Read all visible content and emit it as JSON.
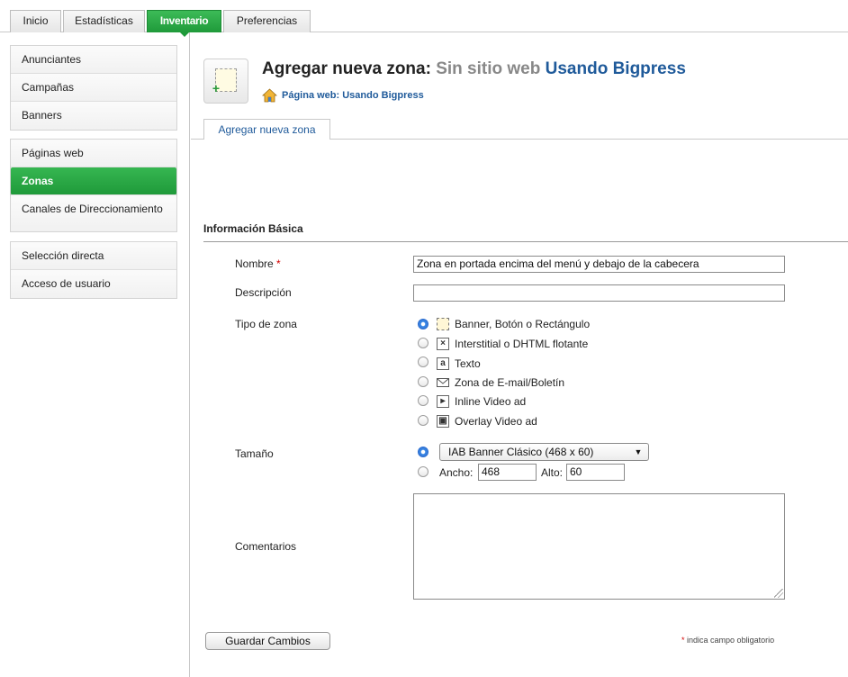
{
  "top_tabs": [
    {
      "label": "Inicio",
      "active": false
    },
    {
      "label": "Estadísticas",
      "active": false
    },
    {
      "label": "Inventario",
      "active": true
    },
    {
      "label": "Preferencias",
      "active": false
    }
  ],
  "sidebar": {
    "group1": [
      "Anunciantes",
      "Campañas",
      "Banners"
    ],
    "group2": [
      "Páginas web",
      "Zonas",
      "Canales de Direccionamiento"
    ],
    "group3": [
      "Selección directa",
      "Acceso de usuario"
    ],
    "active": "Zonas"
  },
  "header": {
    "title_prefix": "Agregar nueva zona:",
    "title_site": "Sin sitio web",
    "title_name": "Usando Bigpress",
    "subtitle": "Página web: Usando Bigpress"
  },
  "page_tab": "Agregar nueva zona",
  "section": "Información Básica",
  "form": {
    "nombre_label": "Nombre",
    "required_mark": "*",
    "nombre_value": "Zona en portada encima del menú y debajo de la cabecera",
    "descripcion_label": "Descripción",
    "descripcion_value": "",
    "tipo_label": "Tipo de zona",
    "tipo_options": [
      {
        "label": "Banner, Botón o Rectángulo",
        "icon": "banner-icon",
        "selected": true
      },
      {
        "label": "Interstitial o DHTML flotante",
        "icon": "interstitial-icon",
        "selected": false
      },
      {
        "label": "Texto",
        "icon": "text-icon",
        "selected": false
      },
      {
        "label": "Zona de E-mail/Boletín",
        "icon": "email-icon",
        "selected": false
      },
      {
        "label": "Inline Video ad",
        "icon": "video-icon",
        "selected": false
      },
      {
        "label": "Overlay Video ad",
        "icon": "overlay-video-icon",
        "selected": false
      }
    ],
    "tamano_label": "Tamaño",
    "tamano_select": "IAB Banner Clásico (468 x 60)",
    "ancho_label": "Ancho:",
    "ancho_value": "468",
    "alto_label": "Alto:",
    "alto_value": "60",
    "comentarios_label": "Comentarios",
    "comentarios_value": ""
  },
  "save_button": "Guardar Cambios",
  "required_note": "indica campo obligatorio",
  "colors": {
    "accent_green": "#1f9a3a",
    "link_blue": "#1f5a9a",
    "required_red": "#d40000"
  }
}
